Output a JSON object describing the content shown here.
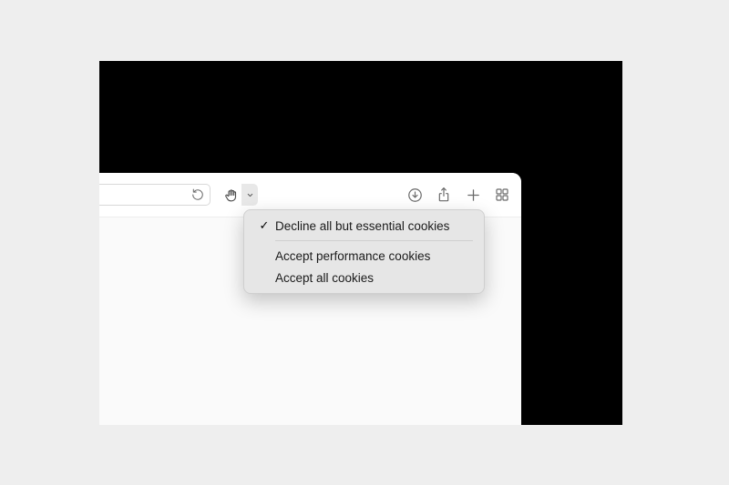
{
  "menu": {
    "items": [
      {
        "label": "Decline all but essential cookies",
        "checked": true
      },
      {
        "label": "Accept performance cookies",
        "checked": false
      },
      {
        "label": "Accept all cookies",
        "checked": false
      }
    ]
  }
}
